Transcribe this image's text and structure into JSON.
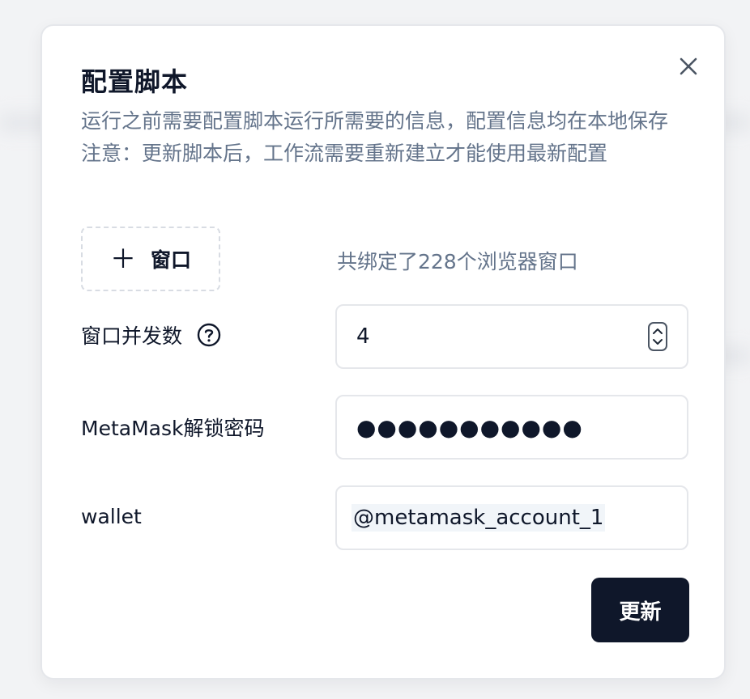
{
  "dialog": {
    "title": "配置脚本",
    "description": [
      "运行之前需要配置脚本运行所需要的信息，配置信息均在本地保存",
      "注意：更新脚本后，工作流需要重新建立才能使用最新配置"
    ],
    "close_icon": "close-icon"
  },
  "windows": {
    "add_button_label": "窗口",
    "add_icon": "plus-icon",
    "bound_count_text": "共绑定了228个浏览器窗口"
  },
  "form": {
    "concurrency": {
      "label": "窗口并发数",
      "value": "4",
      "help_icon": "question-circle-icon"
    },
    "metamask_password": {
      "label": "MetaMask解锁密码",
      "masked_value": "●●●●●●●●●●●"
    },
    "wallet": {
      "label": "wallet",
      "value": "@metamask_account_1"
    }
  },
  "actions": {
    "update_label": "更新"
  },
  "colors": {
    "primary": "#0f172a",
    "muted_text": "#64748b",
    "border": "#e5e7eb"
  }
}
